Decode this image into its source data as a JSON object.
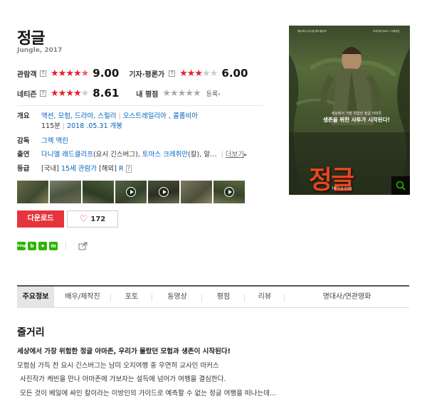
{
  "movie": {
    "title": "정글",
    "subtitle": "Jungle, 2017"
  },
  "ratings": {
    "audience": {
      "label": "관람객",
      "stars": 4.5,
      "score": "9.00"
    },
    "critics": {
      "label": "기자·평론가",
      "stars": 3,
      "score": "6.00"
    },
    "netizen": {
      "label": "네티즌",
      "stars": 4,
      "score": "8.61"
    },
    "my": {
      "label": "내 평점",
      "register": "등록›"
    },
    "help_glyph": "?"
  },
  "info": {
    "overview_label": "개요",
    "genres": "액션, 모험, 드라마, 스릴러",
    "countries": "오스트레일리아 , 콜롬비아",
    "runtime": "115분",
    "release": "2018 .05.31 개봉",
    "director_label": "감독",
    "director": "그렉 맥린",
    "cast_label": "출연",
    "cast_1": "다니엘 래드클리프",
    "cast_1_role": "(요시 긴스버그),",
    "cast_2": "토마스 크레취만",
    "cast_2_role": "(칼),",
    "cast_ellipsis": "알…",
    "more": "더보기",
    "more_arrow": "▸",
    "grade_label": "등급",
    "grade_korea_tag": "[국내]",
    "grade_korea": "15세 관람가",
    "grade_overseas_tag": "[해외]",
    "grade_overseas": "R"
  },
  "actions": {
    "download": "다운로드",
    "like_count": "172",
    "heart": "♡"
  },
  "social": {
    "blog_glyph": "blog",
    "band_glyph": "b",
    "star_glyph": "★",
    "me_glyph": "m"
  },
  "poster": {
    "credit_left": "해리포터 다니엘 래드클리프",
    "credit_right": "아카데미 토마스 크레취만",
    "tagline_1": "세상에서 가장 위험한 정글 아마존",
    "tagline_2": "생존을 위한 사투가 시작된다!",
    "title": "정글",
    "title_en": "JUNGLE",
    "date": "5월 31일 대개봉",
    "zoom_glyph": "🔍"
  },
  "tabs": [
    {
      "label": "주요정보",
      "active": true
    },
    {
      "label": "배우/제작진"
    },
    {
      "label": "포토"
    },
    {
      "label": "동영상"
    },
    {
      "label": "평점"
    },
    {
      "label": "리뷰"
    },
    {
      "label": "명대사/연관영화"
    }
  ],
  "plot": {
    "heading": "줄거리",
    "lead": "세상에서 가장 위험한 정글 아마존, 우리가 몰랐던 모험과 생존이 시작된다!",
    "line1": "모험심 가득 찬 요시 긴스버그는 남미 오지여행 중 우연히 교사인 마커스",
    "line2": "사진작가 케빈을 만나 아마존에 가보자는 설득에 넘어가 여행을 결심한다.",
    "line3": "모든 것이 베일에 싸인 칼이라는 이방인의 가이드로 예측할 수 없는 정글 여행을 떠나는데…"
  },
  "colors": {
    "accent_red": "#e5343b",
    "link_blue": "#0060c0",
    "poster_title": "#e8451c"
  }
}
